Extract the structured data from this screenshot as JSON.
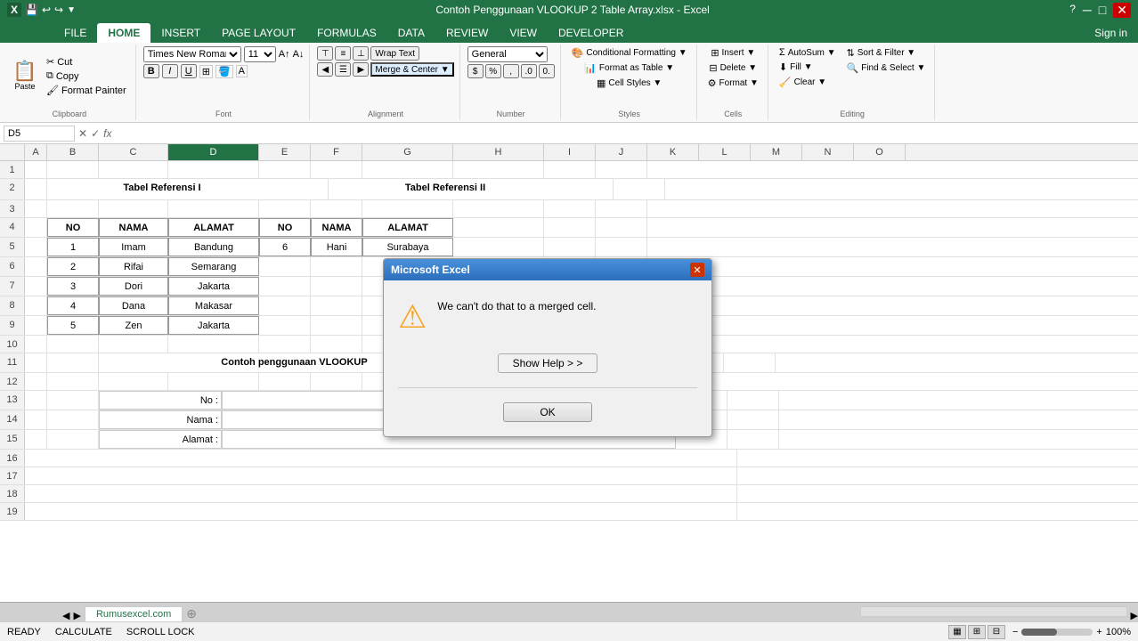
{
  "title_bar": {
    "title": "Contoh Penggunaan VLOOKUP 2 Table Array.xlsx - Excel",
    "app_icon": "X",
    "min": "─",
    "max": "□",
    "close": "✕"
  },
  "quick_access": [
    "save",
    "undo",
    "redo"
  ],
  "ribbon": {
    "tabs": [
      "FILE",
      "HOME",
      "INSERT",
      "PAGE LAYOUT",
      "FORMULAS",
      "DATA",
      "REVIEW",
      "VIEW",
      "DEVELOPER"
    ],
    "active_tab": "HOME",
    "groups": {
      "clipboard": {
        "label": "Clipboard",
        "buttons": [
          {
            "label": "Paste",
            "icon": "📋"
          },
          {
            "label": "Cut",
            "icon": "✂"
          },
          {
            "label": "Copy",
            "icon": "⧉"
          },
          {
            "label": "Format Painter",
            "icon": "🖌"
          }
        ]
      },
      "font": {
        "label": "Font",
        "font_name": "Times New Roman",
        "font_size": "11"
      },
      "alignment": {
        "label": "Alignment"
      },
      "number": {
        "label": "Number"
      },
      "styles": {
        "label": "Styles",
        "conditional_formatting": "Conditional Formatting",
        "format_as_table": "Format as Table",
        "cell_styles": "Cell Styles"
      },
      "cells": {
        "label": "Cells",
        "insert": "Insert",
        "delete": "Delete",
        "format": "Format"
      },
      "editing": {
        "label": "Editing",
        "autosum": "AutoSum",
        "fill": "Fill",
        "clear": "Clear",
        "sort_filter": "Sort & Filter",
        "find_select": "Find & Select"
      }
    }
  },
  "formula_bar": {
    "name_box": "D5",
    "formula": ""
  },
  "columns": [
    "A",
    "B",
    "C",
    "D",
    "E",
    "F",
    "G",
    "H",
    "I",
    "J",
    "K",
    "L",
    "M",
    "N",
    "O"
  ],
  "rows": [
    {
      "num": "1",
      "cells": {}
    },
    {
      "num": "2",
      "cells": {
        "B": "Tabel Referensi I",
        "F": "Tabel Referensi II"
      }
    },
    {
      "num": "3",
      "cells": {}
    },
    {
      "num": "4",
      "cells": {
        "B": "NO",
        "C": "NAMA",
        "D": "ALAMAT",
        "E": "NO",
        "F": "NAMA",
        "G": "ALAMAT"
      }
    },
    {
      "num": "5",
      "cells": {
        "B": "1",
        "C": "Imam",
        "D": "Bandung",
        "E": "6",
        "F": "Hani",
        "G": "Surabaya"
      }
    },
    {
      "num": "6",
      "cells": {
        "B": "2",
        "C": "Rifai",
        "D": "Semarang"
      }
    },
    {
      "num": "7",
      "cells": {
        "B": "3",
        "C": "Dori",
        "D": "Jakarta"
      }
    },
    {
      "num": "8",
      "cells": {
        "B": "4",
        "C": "Dana",
        "D": "Makasar"
      }
    },
    {
      "num": "9",
      "cells": {
        "B": "5",
        "C": "Zen",
        "D": "Jakarta"
      }
    },
    {
      "num": "10",
      "cells": {}
    },
    {
      "num": "11",
      "cells": {
        "C": "Contoh penggunaan VLOOKUP"
      }
    },
    {
      "num": "12",
      "cells": {}
    },
    {
      "num": "13",
      "cells": {
        "C": "No :",
        "D": ""
      }
    },
    {
      "num": "14",
      "cells": {
        "C": "Nama :",
        "D": ""
      }
    },
    {
      "num": "15",
      "cells": {
        "C": "Alamat :",
        "D": ""
      }
    },
    {
      "num": "16",
      "cells": {}
    },
    {
      "num": "17",
      "cells": {}
    },
    {
      "num": "18",
      "cells": {}
    },
    {
      "num": "19",
      "cells": {}
    }
  ],
  "dialog": {
    "title": "Microsoft Excel",
    "message": "We can't do that to a merged cell.",
    "show_help_btn": "Show Help > >",
    "ok_btn": "OK",
    "icon": "⚠"
  },
  "status_bar": {
    "ready": "READY",
    "calculate": "CALCULATE",
    "scroll_lock": "SCROLL LOCK",
    "zoom": "100%",
    "sheet_tab": "Rumusexcel.com"
  }
}
